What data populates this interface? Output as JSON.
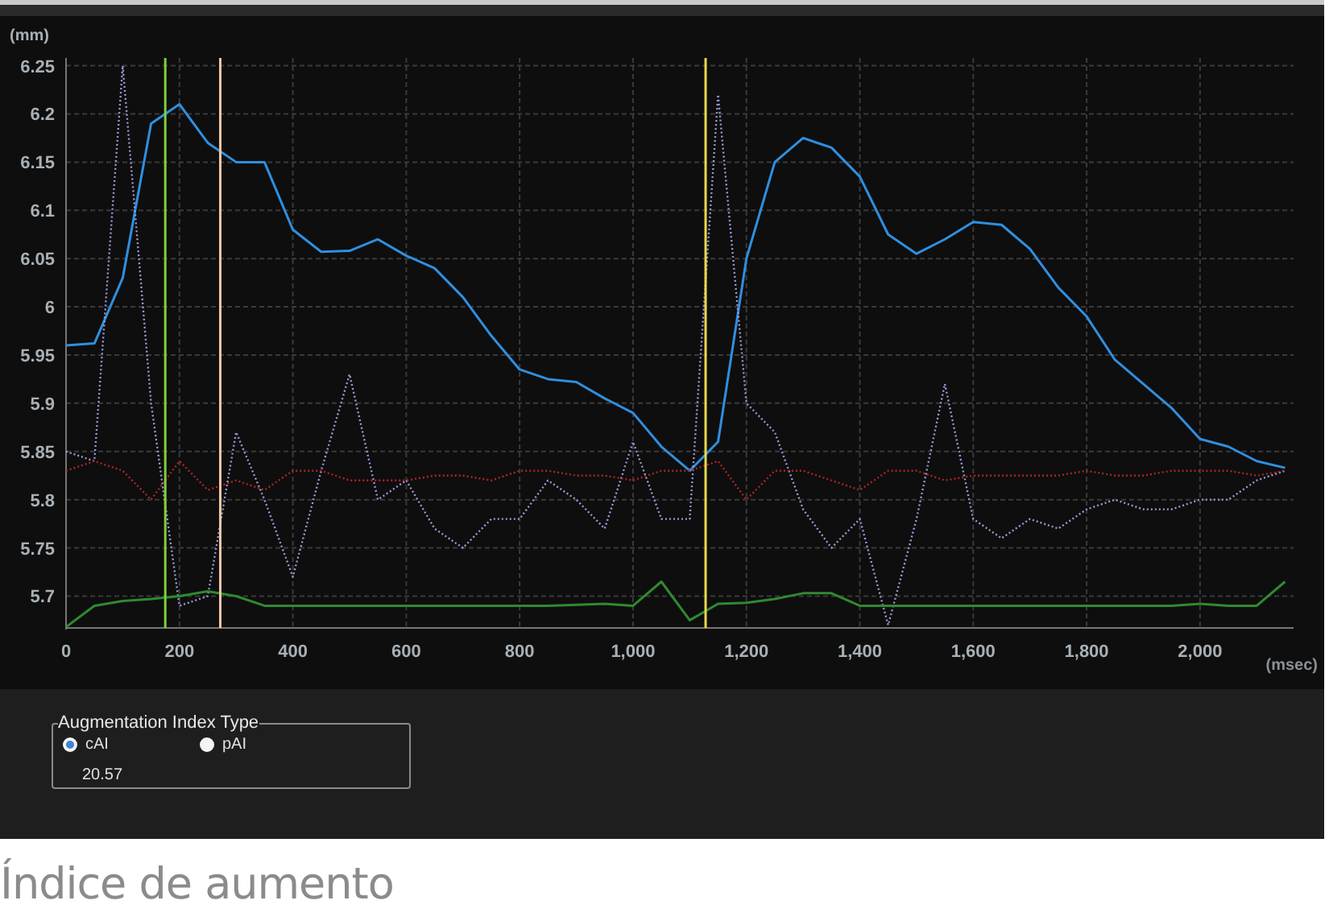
{
  "chart": {
    "chart_data": {
      "type": "line",
      "xlabel": "(msec)",
      "ylabel": "(mm)",
      "x": [
        0,
        50,
        100,
        150,
        200,
        250,
        300,
        350,
        400,
        450,
        500,
        550,
        600,
        650,
        700,
        750,
        800,
        850,
        900,
        950,
        1000,
        1050,
        1100,
        1150,
        1200,
        1250,
        1300,
        1350,
        1400,
        1450,
        1500,
        1550,
        1600,
        1650,
        1700,
        1750,
        1800,
        1850,
        1900,
        1950,
        2000,
        2050,
        2100,
        2150
      ],
      "series": [
        {
          "color": "#2f8fe0",
          "line_style": "solid",
          "values": [
            5.96,
            5.962,
            6.03,
            6.19,
            6.21,
            6.17,
            6.15,
            6.15,
            6.08,
            6.057,
            6.058,
            6.07,
            6.053,
            6.04,
            6.01,
            5.97,
            5.935,
            5.925,
            5.922,
            5.905,
            5.89,
            5.855,
            5.83,
            5.86,
            6.05,
            6.15,
            6.175,
            6.165,
            6.135,
            6.075,
            6.055,
            6.07,
            6.088,
            6.085,
            6.06,
            6.02,
            5.99,
            5.945,
            5.92,
            5.895,
            5.863,
            5.855,
            5.84,
            5.833
          ]
        },
        {
          "color": "#9a9ad8",
          "line_style": "dotted",
          "values": [
            5.85,
            5.84,
            6.25,
            5.9,
            5.69,
            5.7,
            5.87,
            5.8,
            5.72,
            5.83,
            5.93,
            5.8,
            5.82,
            5.77,
            5.75,
            5.78,
            5.78,
            5.82,
            5.8,
            5.77,
            5.86,
            5.78,
            5.78,
            6.22,
            5.9,
            5.87,
            5.79,
            5.75,
            5.78,
            5.67,
            5.78,
            5.92,
            5.78,
            5.76,
            5.78,
            5.77,
            5.79,
            5.8,
            5.79,
            5.79,
            5.8,
            5.8,
            5.82,
            5.83
          ]
        },
        {
          "color": "#b02424",
          "line_style": "dotted",
          "values": [
            5.83,
            5.84,
            5.83,
            5.8,
            5.84,
            5.81,
            5.82,
            5.81,
            5.83,
            5.83,
            5.82,
            5.82,
            5.82,
            5.825,
            5.825,
            5.82,
            5.83,
            5.83,
            5.825,
            5.825,
            5.82,
            5.83,
            5.83,
            5.84,
            5.8,
            5.83,
            5.83,
            5.82,
            5.81,
            5.83,
            5.83,
            5.82,
            5.825,
            5.825,
            5.825,
            5.825,
            5.83,
            5.825,
            5.825,
            5.83,
            5.83,
            5.83,
            5.825,
            5.83
          ]
        },
        {
          "color": "#2f8a2f",
          "line_style": "solid",
          "values": [
            5.668,
            5.69,
            5.695,
            5.697,
            5.7,
            5.705,
            5.7,
            5.69,
            5.69,
            5.69,
            5.69,
            5.69,
            5.69,
            5.69,
            5.69,
            5.69,
            5.69,
            5.69,
            5.691,
            5.692,
            5.69,
            5.715,
            5.675,
            5.692,
            5.693,
            5.697,
            5.703,
            5.703,
            5.69,
            5.69,
            5.69,
            5.69,
            5.69,
            5.69,
            5.69,
            5.69,
            5.69,
            5.69,
            5.69,
            5.69,
            5.692,
            5.69,
            5.69,
            5.715
          ]
        }
      ],
      "xlim": [
        0,
        2165
      ],
      "ylim": [
        5.667,
        6.258
      ],
      "xticks": [
        0,
        200,
        400,
        600,
        800,
        {
          "value": 1000,
          "label": "1,000"
        },
        {
          "value": 1200,
          "label": "1,200"
        },
        {
          "value": 1400,
          "label": "1,400"
        },
        {
          "value": 1600,
          "label": "1,600"
        },
        {
          "value": 1800,
          "label": "1,800"
        },
        {
          "value": 2000,
          "label": "2,000"
        }
      ],
      "yticks": [
        5.7,
        5.75,
        5.8,
        5.85,
        5.9,
        5.95,
        6,
        6.05,
        6.1,
        6.15,
        6.2,
        6.25
      ],
      "grid": true,
      "ref_lines": [
        {
          "axis": "x",
          "value": 175,
          "color": "#7ed03a"
        },
        {
          "axis": "x",
          "value": 272,
          "color": "#f4c8a8"
        },
        {
          "axis": "x",
          "value": 1128,
          "color": "#e6d84e"
        }
      ]
    }
  },
  "augmentation_index": {
    "title": "Augmentation Index Type",
    "options": [
      {
        "label": "cAI",
        "selected": true
      },
      {
        "label": "pAI",
        "selected": false
      }
    ],
    "value": "20.57"
  },
  "caption": "Índice de aumento"
}
